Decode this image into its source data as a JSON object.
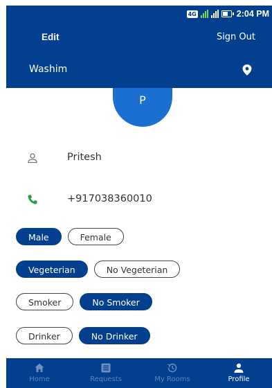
{
  "status_bar": {
    "network": "4G",
    "time": "2:04 PM"
  },
  "header": {
    "edit_label": "Edit",
    "signout_label": "Sign Out",
    "location": "Washim",
    "location_icon": "map-pin-icon"
  },
  "profile": {
    "avatar_initial": "P",
    "name": "Pritesh",
    "name_icon": "person-icon",
    "phone": "+917038360010",
    "phone_icon": "phone-icon"
  },
  "preferences": {
    "gender": [
      {
        "label": "Male",
        "selected": true
      },
      {
        "label": "Female",
        "selected": false
      }
    ],
    "diet": [
      {
        "label": "Vegeterian",
        "selected": true
      },
      {
        "label": "No Vegeterian",
        "selected": false
      }
    ],
    "smoking": [
      {
        "label": "Smoker",
        "selected": false
      },
      {
        "label": "No Smoker",
        "selected": true
      }
    ],
    "drinking": [
      {
        "label": "Drinker",
        "selected": false
      },
      {
        "label": "No Drinker",
        "selected": true
      }
    ]
  },
  "bottom_nav": {
    "items": [
      {
        "label": "Home",
        "icon": "home-icon",
        "active": false
      },
      {
        "label": "Requests",
        "icon": "list-icon",
        "active": false
      },
      {
        "label": "My Rooms",
        "icon": "history-icon",
        "active": false
      },
      {
        "label": "Profile",
        "icon": "profile-icon",
        "active": true
      }
    ]
  },
  "colors": {
    "primary": "#023f8e",
    "avatar": "#1b6fd1",
    "phone_icon": "#2e9e3e",
    "nav_inactive": "#5f84b8"
  }
}
